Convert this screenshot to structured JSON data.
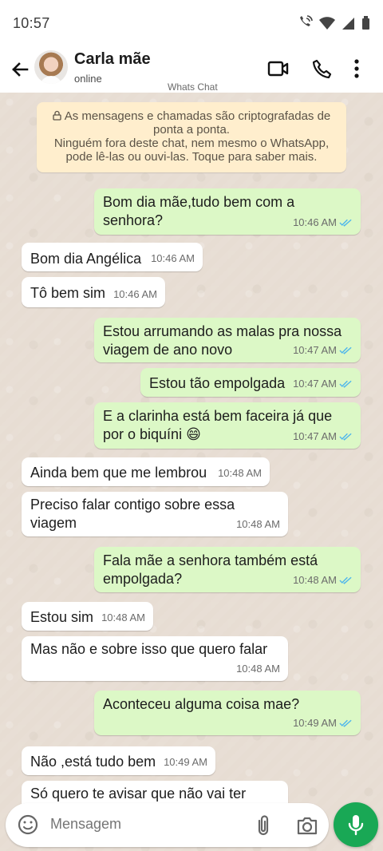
{
  "status_bar": {
    "time": "10:57"
  },
  "header": {
    "contact_name": "Carla mãe",
    "contact_status": "online",
    "app_title": "Whats Chat"
  },
  "encryption_notice": {
    "line1": "As mensagens e chamadas são criptografadas de",
    "line2": "ponta a ponta.",
    "line3": "Ninguém fora deste chat, nem mesmo o WhatsApp,",
    "line4": "pode lê-las ou ouvi-las. Toque para saber mais."
  },
  "messages": [
    {
      "direction": "out",
      "lines": [
        "Bom dia mãe,tudo bem com a",
        "senhora?"
      ],
      "time": "10:46 AM",
      "read": true
    },
    {
      "direction": "in",
      "lines": [
        "Bom dia Angélica"
      ],
      "time": "10:46 AM"
    },
    {
      "direction": "in",
      "lines": [
        "Tô bem sim"
      ],
      "time": "10:46 AM"
    },
    {
      "direction": "out",
      "lines": [
        "Estou arrumando as malas pra nossa",
        "viagem de ano novo"
      ],
      "time": "10:47 AM",
      "read": true
    },
    {
      "direction": "out",
      "lines": [
        "Estou tão empolgada"
      ],
      "time": "10:47 AM",
      "read": true
    },
    {
      "direction": "out",
      "lines": [
        "E a clarinha está bem faceira já que",
        "por o biquíni 😄"
      ],
      "time": "10:47 AM",
      "read": true
    },
    {
      "direction": "in",
      "lines": [
        "Ainda bem que me lembrou"
      ],
      "time": "10:48 AM"
    },
    {
      "direction": "in",
      "lines": [
        "Preciso falar contigo sobre essa",
        "viagem"
      ],
      "time": "10:48 AM"
    },
    {
      "direction": "out",
      "lines": [
        "Fala mãe a senhora também está",
        "empolgada?"
      ],
      "time": "10:48 AM",
      "read": true
    },
    {
      "direction": "in",
      "lines": [
        "Estou sim"
      ],
      "time": "10:48 AM"
    },
    {
      "direction": "in",
      "lines": [
        "Mas não e sobre isso que quero falar"
      ],
      "time": "10:48 AM"
    },
    {
      "direction": "out",
      "lines": [
        "Aconteceu alguma coisa mae?"
      ],
      "time": "10:49 AM",
      "read": true
    },
    {
      "direction": "in",
      "lines": [
        "Não ,está tudo bem"
      ],
      "time": "10:49 AM"
    },
    {
      "direction": "in",
      "lines": [
        "Só quero te avisar que não vai ter"
      ],
      "time": ""
    }
  ],
  "composer": {
    "placeholder": "Mensagem"
  },
  "colors": {
    "outgoing_bubble": "#dcf8c6",
    "incoming_bubble": "#ffffff",
    "encryption_notice": "#ffeecd",
    "chat_background": "#e7ddd3",
    "mic_button": "#19a855",
    "read_tick": "#4fb6ec"
  },
  "icons": {
    "back": "arrow-left-icon",
    "video": "video-camera-icon",
    "call": "phone-icon",
    "menu": "more-vertical-icon",
    "lock": "lock-icon",
    "emoji": "emoji-icon",
    "attach": "paperclip-icon",
    "camera": "camera-icon",
    "mic": "microphone-icon"
  }
}
